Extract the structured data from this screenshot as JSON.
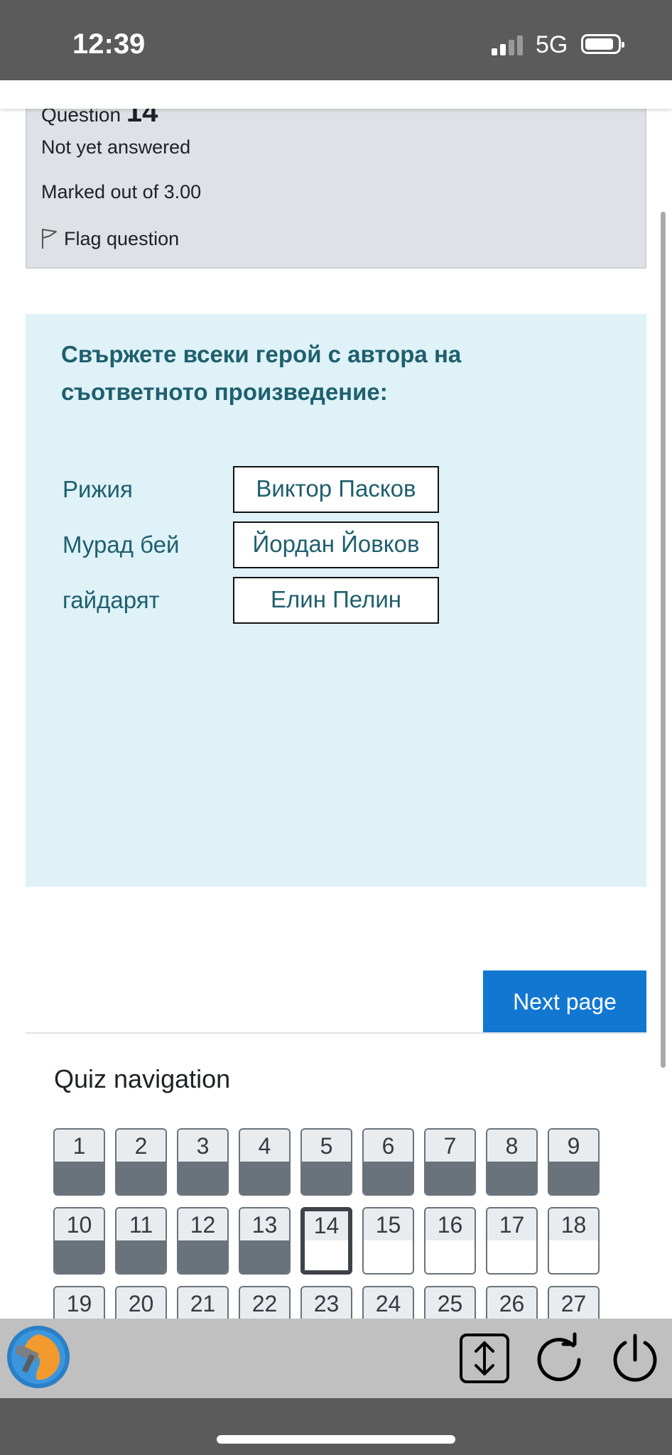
{
  "status_bar": {
    "time": "12:39",
    "network": "5G"
  },
  "question_info": {
    "heading_label": "Question",
    "number": "14",
    "status": "Not yet answered",
    "marks": "Marked out of 3.00",
    "flag_label": "Flag question"
  },
  "question": {
    "text": "Свържете всеки герой с автора на съответното произведение:",
    "matches": [
      {
        "label": "Рижия",
        "selected": "Виктор Пасков"
      },
      {
        "label": "Мурад бей",
        "selected": "Йордан Йовков"
      },
      {
        "label": "гайдарят",
        "selected": "Елин Пелин"
      }
    ]
  },
  "next_button": "Next page",
  "quiz_nav": {
    "title": "Quiz navigation",
    "buttons": [
      {
        "n": "1",
        "state": "answered"
      },
      {
        "n": "2",
        "state": "answered"
      },
      {
        "n": "3",
        "state": "answered"
      },
      {
        "n": "4",
        "state": "answered"
      },
      {
        "n": "5",
        "state": "answered"
      },
      {
        "n": "6",
        "state": "answered"
      },
      {
        "n": "7",
        "state": "answered"
      },
      {
        "n": "8",
        "state": "answered"
      },
      {
        "n": "9",
        "state": "answered"
      },
      {
        "n": "10",
        "state": "answered"
      },
      {
        "n": "11",
        "state": "answered"
      },
      {
        "n": "12",
        "state": "answered"
      },
      {
        "n": "13",
        "state": "answered"
      },
      {
        "n": "14",
        "state": "current"
      },
      {
        "n": "15",
        "state": "unanswered"
      },
      {
        "n": "16",
        "state": "unanswered"
      },
      {
        "n": "17",
        "state": "unanswered"
      },
      {
        "n": "18",
        "state": "unanswered"
      },
      {
        "n": "19",
        "state": "unanswered"
      },
      {
        "n": "20",
        "state": "unanswered"
      },
      {
        "n": "21",
        "state": "unanswered"
      },
      {
        "n": "22",
        "state": "unanswered"
      },
      {
        "n": "23",
        "state": "unanswered"
      },
      {
        "n": "24",
        "state": "unanswered"
      },
      {
        "n": "25",
        "state": "unanswered"
      },
      {
        "n": "26",
        "state": "unanswered"
      },
      {
        "n": "27",
        "state": "unanswered"
      }
    ]
  },
  "toolbar": {
    "icons": [
      "app-logo-icon",
      "expand-vertical-icon",
      "reload-icon",
      "power-icon"
    ]
  },
  "colors": {
    "accent": "#1177d1",
    "question_bg": "#def2f8",
    "info_bg": "#dee2e6",
    "question_text": "#1f5f6e",
    "answered_fill": "#6a737b"
  }
}
